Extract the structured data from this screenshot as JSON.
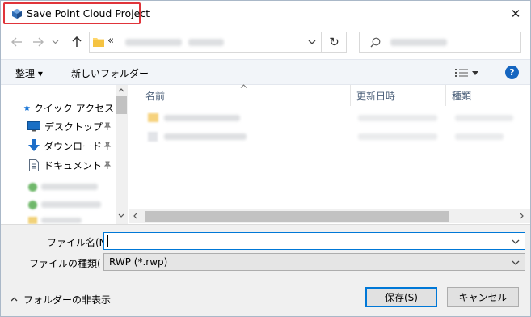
{
  "window": {
    "title": "Save Point Cloud Project",
    "close_symbol": "✕"
  },
  "nav": {
    "address_chevron": "«",
    "refresh_symbol": "↻",
    "search_icon": "search-icon"
  },
  "toolbar": {
    "organize_label": "整理 ▾",
    "new_folder_label": "新しいフォルダー",
    "help_symbol": "?"
  },
  "sidebar": {
    "items": [
      {
        "label": "クイック アクセス",
        "icon": "star-icon",
        "color": "#1e78d7"
      },
      {
        "label": "デスクトップ",
        "icon": "desktop-icon",
        "color": "#1a6fc4",
        "pinned": "pin-icon"
      },
      {
        "label": "ダウンロード",
        "icon": "download-icon",
        "color": "#1d6ec9",
        "pinned": "pin-icon"
      },
      {
        "label": "ドキュメント",
        "icon": "document-icon",
        "color": "#5a6b80",
        "pinned": "pin-icon"
      }
    ]
  },
  "columns": {
    "name": "名前",
    "modified": "更新日時",
    "type": "種類"
  },
  "form": {
    "filename_label": "ファイル名(N):",
    "filename_value": "",
    "filetype_label": "ファイルの種類(T):",
    "filetype_value": "RWP (*.rwp)"
  },
  "footer": {
    "hide_folders_label": "フォルダーの非表示",
    "save_label": "保存(S)",
    "cancel_label": "キャンセル"
  },
  "colors": {
    "accent": "#0078d7",
    "highlight": "#e0343a",
    "help": "#1565c0"
  }
}
